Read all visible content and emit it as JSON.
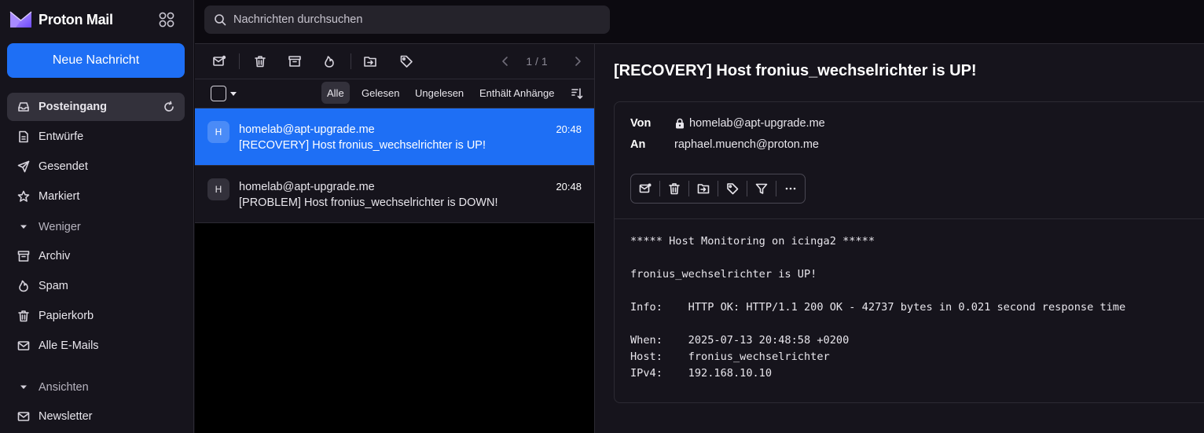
{
  "app": {
    "brand": "Proton Mail"
  },
  "colors": {
    "accent": "#1e6ff5",
    "sidebar_bg": "#16141c",
    "list_bg": "#000000",
    "active_nav_bg": "#33313b"
  },
  "sidebar": {
    "compose_label": "Neue Nachricht",
    "items": [
      {
        "label": "Posteingang",
        "icon": "inbox-icon",
        "active": true
      },
      {
        "label": "Entwürfe",
        "icon": "draft-icon"
      },
      {
        "label": "Gesendet",
        "icon": "paper-plane-icon"
      },
      {
        "label": "Markiert",
        "icon": "star-icon"
      },
      {
        "label": "Weniger",
        "icon": "caret-down-icon",
        "section": true
      },
      {
        "label": "Archiv",
        "icon": "archive-icon"
      },
      {
        "label": "Spam",
        "icon": "fire-icon"
      },
      {
        "label": "Papierkorb",
        "icon": "trash-icon"
      },
      {
        "label": "Alle E-Mails",
        "icon": "envelope-icon"
      },
      {
        "label": "Ansichten",
        "icon": "caret-down-icon",
        "section": true
      },
      {
        "label": "Newsletter",
        "icon": "envelope-icon"
      }
    ]
  },
  "search": {
    "placeholder": "Nachrichten durchsuchen"
  },
  "list": {
    "pager": "1 / 1",
    "filters": [
      "Alle",
      "Gelesen",
      "Ungelesen",
      "Enthält Anhänge"
    ],
    "active_filter": "Alle",
    "messages": [
      {
        "avatar": "H",
        "from": "homelab@apt-upgrade.me",
        "subject": "[RECOVERY] Host fronius_wechselrichter is UP!",
        "time": "20:48",
        "selected": true
      },
      {
        "avatar": "H",
        "from": "homelab@apt-upgrade.me",
        "subject": "[PROBLEM] Host fronius_wechselrichter is DOWN!",
        "time": "20:48",
        "selected": false
      }
    ]
  },
  "reader": {
    "title": "[RECOVERY] Host fronius_wechselrichter is UP!",
    "from_label": "Von",
    "from": "homelab@apt-upgrade.me",
    "to_label": "An",
    "to": "raphael.muench@proton.me",
    "body": [
      "***** Host Monitoring on icinga2 *****",
      "",
      "fronius_wechselrichter is UP!",
      "",
      "Info:    HTTP OK: HTTP/1.1 200 OK - 42737 bytes in 0.021 second response time",
      "",
      "When:    2025-07-13 20:48:58 +0200",
      "Host:    fronius_wechselrichter",
      "IPv4:    192.168.10.10"
    ]
  }
}
